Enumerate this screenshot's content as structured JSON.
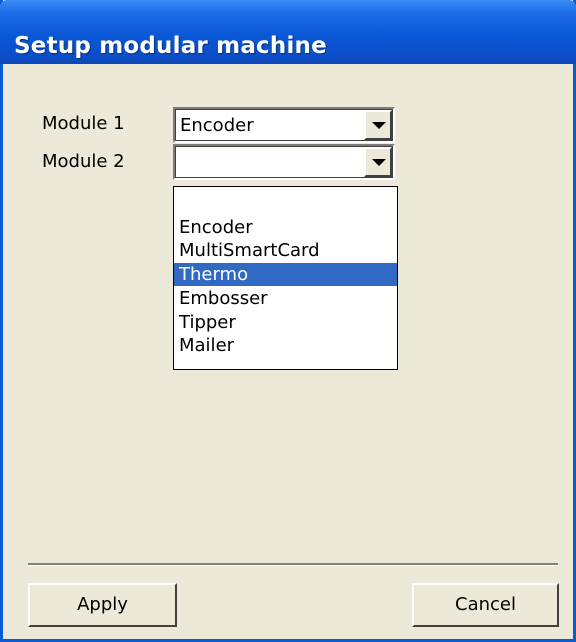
{
  "window": {
    "title": "Setup modular machine"
  },
  "form": {
    "module1": {
      "label": "Module 1",
      "value": "Encoder"
    },
    "module2": {
      "label": "Module 2",
      "value": ""
    }
  },
  "dropdown": {
    "items": [
      {
        "label": "",
        "selected": false
      },
      {
        "label": "Encoder",
        "selected": false
      },
      {
        "label": "MultiSmartCard",
        "selected": false
      },
      {
        "label": "Thermo",
        "selected": true
      },
      {
        "label": "Embosser",
        "selected": false
      },
      {
        "label": "Tipper",
        "selected": false
      },
      {
        "label": "Mailer",
        "selected": false
      }
    ]
  },
  "buttons": {
    "apply": "Apply",
    "cancel": "Cancel"
  },
  "colors": {
    "titlebar": "#0a58d6",
    "dialog_bg": "#ece9d8",
    "selection": "#316ac5"
  }
}
